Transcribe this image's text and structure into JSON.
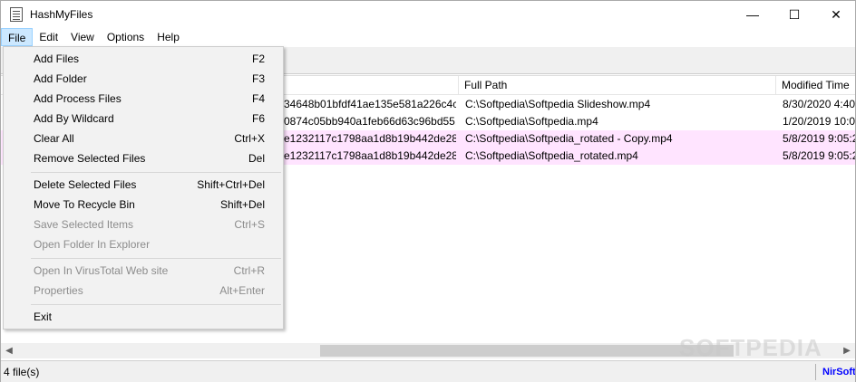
{
  "window": {
    "title": "HashMyFiles",
    "minimize": "—",
    "maximize": "☐",
    "close": "✕"
  },
  "menubar": {
    "file": "File",
    "edit": "Edit",
    "view": "View",
    "options": "Options",
    "help": "Help"
  },
  "file_menu": {
    "items": [
      {
        "label": "Add Files",
        "shortcut": "F2"
      },
      {
        "label": "Add Folder",
        "shortcut": "F3"
      },
      {
        "label": "Add Process Files",
        "shortcut": "F4"
      },
      {
        "label": "Add By Wildcard",
        "shortcut": "F6"
      },
      {
        "label": "Clear All",
        "shortcut": "Ctrl+X"
      },
      {
        "label": "Remove Selected Files",
        "shortcut": "Del"
      },
      {
        "label": "Delete Selected Files",
        "shortcut": "Shift+Ctrl+Del"
      },
      {
        "label": "Move To Recycle Bin",
        "shortcut": "Shift+Del"
      },
      {
        "label": "Save Selected Items",
        "shortcut": "Ctrl+S"
      },
      {
        "label": "Open Folder In Explorer",
        "shortcut": ""
      },
      {
        "label": "Open In VirusTotal Web site",
        "shortcut": "Ctrl+R"
      },
      {
        "label": "Properties",
        "shortcut": "Alt+Enter"
      },
      {
        "label": "Exit",
        "shortcut": ""
      }
    ]
  },
  "table": {
    "headers": {
      "full_path": "Full Path",
      "modified_time": "Modified Time"
    },
    "rows": [
      {
        "hash": "34648b01bfdf41ae135e581a226c4c...",
        "path": "C:\\Softpedia\\Softpedia Slideshow.mp4",
        "modified": "8/30/2020 4:40:",
        "highlight": false
      },
      {
        "hash": "0874c05bb940a1feb66d63c96bd55...",
        "path": "C:\\Softpedia\\Softpedia.mp4",
        "modified": "1/20/2019 10:05",
        "highlight": false
      },
      {
        "hash": "e1232117c1798aa1d8b19b442de28...",
        "path": "C:\\Softpedia\\Softpedia_rotated - Copy.mp4",
        "modified": "5/8/2019 9:05:2",
        "highlight": true
      },
      {
        "hash": "e1232117c1798aa1d8b19b442de28...",
        "path": "C:\\Softpedia\\Softpedia_rotated.mp4",
        "modified": "5/8/2019 9:05:2",
        "highlight": true
      }
    ]
  },
  "scrollbar": {
    "left_arrow": "◀",
    "right_arrow": "▶"
  },
  "statusbar": {
    "count": "4 file(s)",
    "link": "NirSoft"
  },
  "watermark": "SOFTPEDIA",
  "colors": {
    "highlight_row": "#ffe4ff",
    "menu_active": "#cce8ff",
    "link": "#0000ff"
  }
}
